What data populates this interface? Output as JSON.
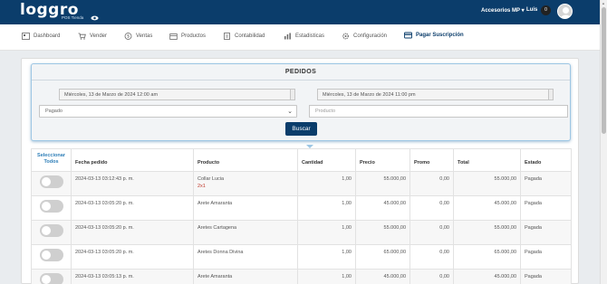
{
  "header": {
    "logo_text": "loggro",
    "logo_subtitle": "POS Tienda",
    "store_name": "Accesorios MP",
    "user_name": "Luis",
    "notification_count": "0"
  },
  "nav": {
    "items": [
      {
        "label": "Dashboard",
        "icon": "dashboard-icon"
      },
      {
        "label": "Vender",
        "icon": "cart-icon"
      },
      {
        "label": "Ventas",
        "icon": "dollar-icon"
      },
      {
        "label": "Productos",
        "icon": "box-icon"
      },
      {
        "label": "Contabilidad",
        "icon": "ledger-icon"
      },
      {
        "label": "Estadisticas",
        "icon": "chart-icon"
      },
      {
        "label": "Configuración",
        "icon": "settings-icon"
      },
      {
        "label": "Pagar Suscripción",
        "icon": "card-icon"
      }
    ],
    "active": "Pagar Suscripción"
  },
  "filter": {
    "title": "PEDIDOS",
    "date_from": "Miércoles, 13 de Marzo de 2024 12:00 am",
    "date_to": "Miércoles, 13 de Marzo de 2024 11:00 pm",
    "status_value": "Pagado",
    "product_placeholder": "Producto",
    "search_label": "Buscar"
  },
  "table": {
    "headers": {
      "select_all": "Seleccionar Todos",
      "date": "Fecha pedido",
      "product": "Producto",
      "quantity": "Cantidad",
      "price": "Precio",
      "promo": "Promo",
      "total": "Total",
      "status": "Estado"
    },
    "rows": [
      {
        "date": "2024-03-13 03:12:43 p. m.",
        "product": "Collar Lucia",
        "promo_tag": "2x1",
        "quantity": "1,00",
        "price": "55.000,00",
        "promo": "0,00",
        "total": "55.000,00",
        "status": "Pagada"
      },
      {
        "date": "2024-03-13 03:05:20 p. m.",
        "product": "Arete Amaranta",
        "promo_tag": "",
        "quantity": "1,00",
        "price": "45.000,00",
        "promo": "0,00",
        "total": "45.000,00",
        "status": "Pagada"
      },
      {
        "date": "2024-03-13 03:05:20 p. m.",
        "product": "Aretes Cartagena",
        "promo_tag": "",
        "quantity": "1,00",
        "price": "55.000,00",
        "promo": "0,00",
        "total": "55.000,00",
        "status": "Pagada"
      },
      {
        "date": "2024-03-13 03:05:20 p. m.",
        "product": "Aretes Donna Divina",
        "promo_tag": "",
        "quantity": "1,00",
        "price": "65.000,00",
        "promo": "0,00",
        "total": "65.000,00",
        "status": "Pagada"
      },
      {
        "date": "2024-03-13 03:05:13 p. m.",
        "product": "Arete Amaranta",
        "promo_tag": "",
        "quantity": "1,00",
        "price": "45.000,00",
        "promo": "0,00",
        "total": "45.000,00",
        "status": "Pagada"
      }
    ]
  },
  "colors": {
    "brand": "#0b3d6b",
    "accent": "#2f7fb8",
    "promo": "#c0392b"
  }
}
